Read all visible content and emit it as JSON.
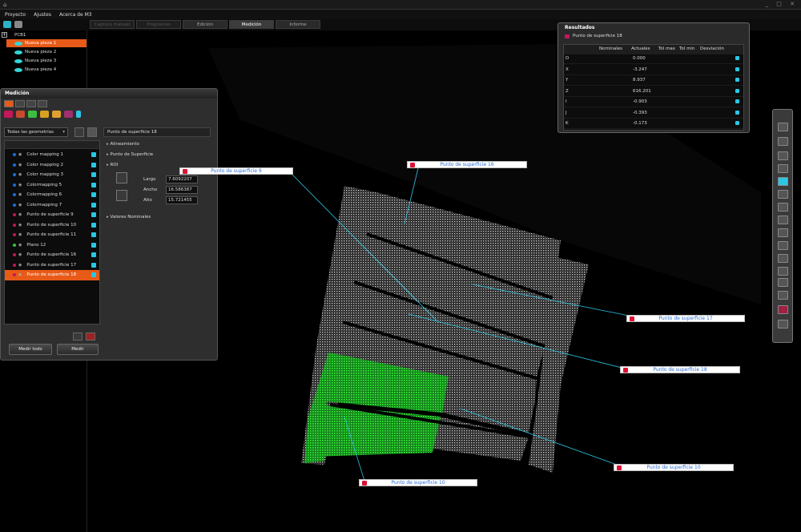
{
  "menu": [
    "Proyecto",
    "Ajustes",
    "Acerca de M3"
  ],
  "tabs": [
    {
      "label": "Captura manual",
      "state": "disabled"
    },
    {
      "label": "Programas",
      "state": "disabled"
    },
    {
      "label": "Edición",
      "state": "normal"
    },
    {
      "label": "Medición",
      "state": "active"
    },
    {
      "label": "Informe",
      "state": "normal"
    }
  ],
  "tree": {
    "root": "PCB1",
    "items": [
      "Nueva pieza 1",
      "Nueva pieza 2",
      "Nueva pieza 3",
      "Nueva pieza 4"
    ],
    "selected_index": 0
  },
  "panel": {
    "title": "Medición",
    "filter": "Todas las geometrías",
    "list": [
      {
        "label": "Color mapping 1",
        "kind": "map"
      },
      {
        "label": "Color mapping 2",
        "kind": "map"
      },
      {
        "label": "Color mapping 3",
        "kind": "map"
      },
      {
        "label": "Colormapping 5",
        "kind": "map"
      },
      {
        "label": "Colormapping 6",
        "kind": "map"
      },
      {
        "label": "Colormapping 7",
        "kind": "map"
      },
      {
        "label": "Punto de superficie 9",
        "kind": "point"
      },
      {
        "label": "Punto de superficie 10",
        "kind": "point"
      },
      {
        "label": "Punto de superficie 11",
        "kind": "point"
      },
      {
        "label": "Plano 12",
        "kind": "plane"
      },
      {
        "label": "Punto de superficie 16",
        "kind": "point"
      },
      {
        "label": "Punto de superficie 17",
        "kind": "point"
      },
      {
        "label": "Punto de superficie 18",
        "kind": "point"
      }
    ],
    "selected_index": 12,
    "detail_title": "Punto de superficie 18",
    "sections": [
      "Alineamiento",
      "Punto de Superficie",
      "ROI",
      "Valores Nominales"
    ],
    "roi": [
      {
        "label": "Largo",
        "value": "7.6092207"
      },
      {
        "label": "Ancho",
        "value": "16.586387"
      },
      {
        "label": "Alto",
        "value": "15.721455"
      }
    ],
    "buttons": {
      "measure_all": "Medir todo",
      "measure": "Medir"
    }
  },
  "results": {
    "title": "Resultados",
    "subject": "Punto de superficie 18",
    "columns": [
      "Nominales",
      "Actuales",
      "Tol max",
      "Tol min",
      "Desviación"
    ],
    "rows": [
      {
        "name": "D",
        "actual": "0.000"
      },
      {
        "name": "X",
        "actual": "-3.247"
      },
      {
        "name": "Y",
        "actual": "8.937"
      },
      {
        "name": "Z",
        "actual": "616.201"
      },
      {
        "name": "I",
        "actual": "-0.903"
      },
      {
        "name": "J",
        "actual": "-0.393"
      },
      {
        "name": "K",
        "actual": "-0.173"
      }
    ]
  },
  "labels": [
    {
      "id": "p9",
      "text": "Punto de superficie 9"
    },
    {
      "id": "p16",
      "text": "Punto de superficie 16"
    },
    {
      "id": "p17",
      "text": "Punto de superficie 17"
    },
    {
      "id": "p18",
      "text": "Punto de superficie 18"
    },
    {
      "id": "p11",
      "text": "Punto de superficie 10"
    },
    {
      "id": "p10",
      "text": "Punto de superficie 10"
    }
  ],
  "colors": {
    "accent": "#e85a17",
    "cyan": "#2bc6e6",
    "label_text": "#2a6fd6",
    "green": "#1fe02a"
  }
}
